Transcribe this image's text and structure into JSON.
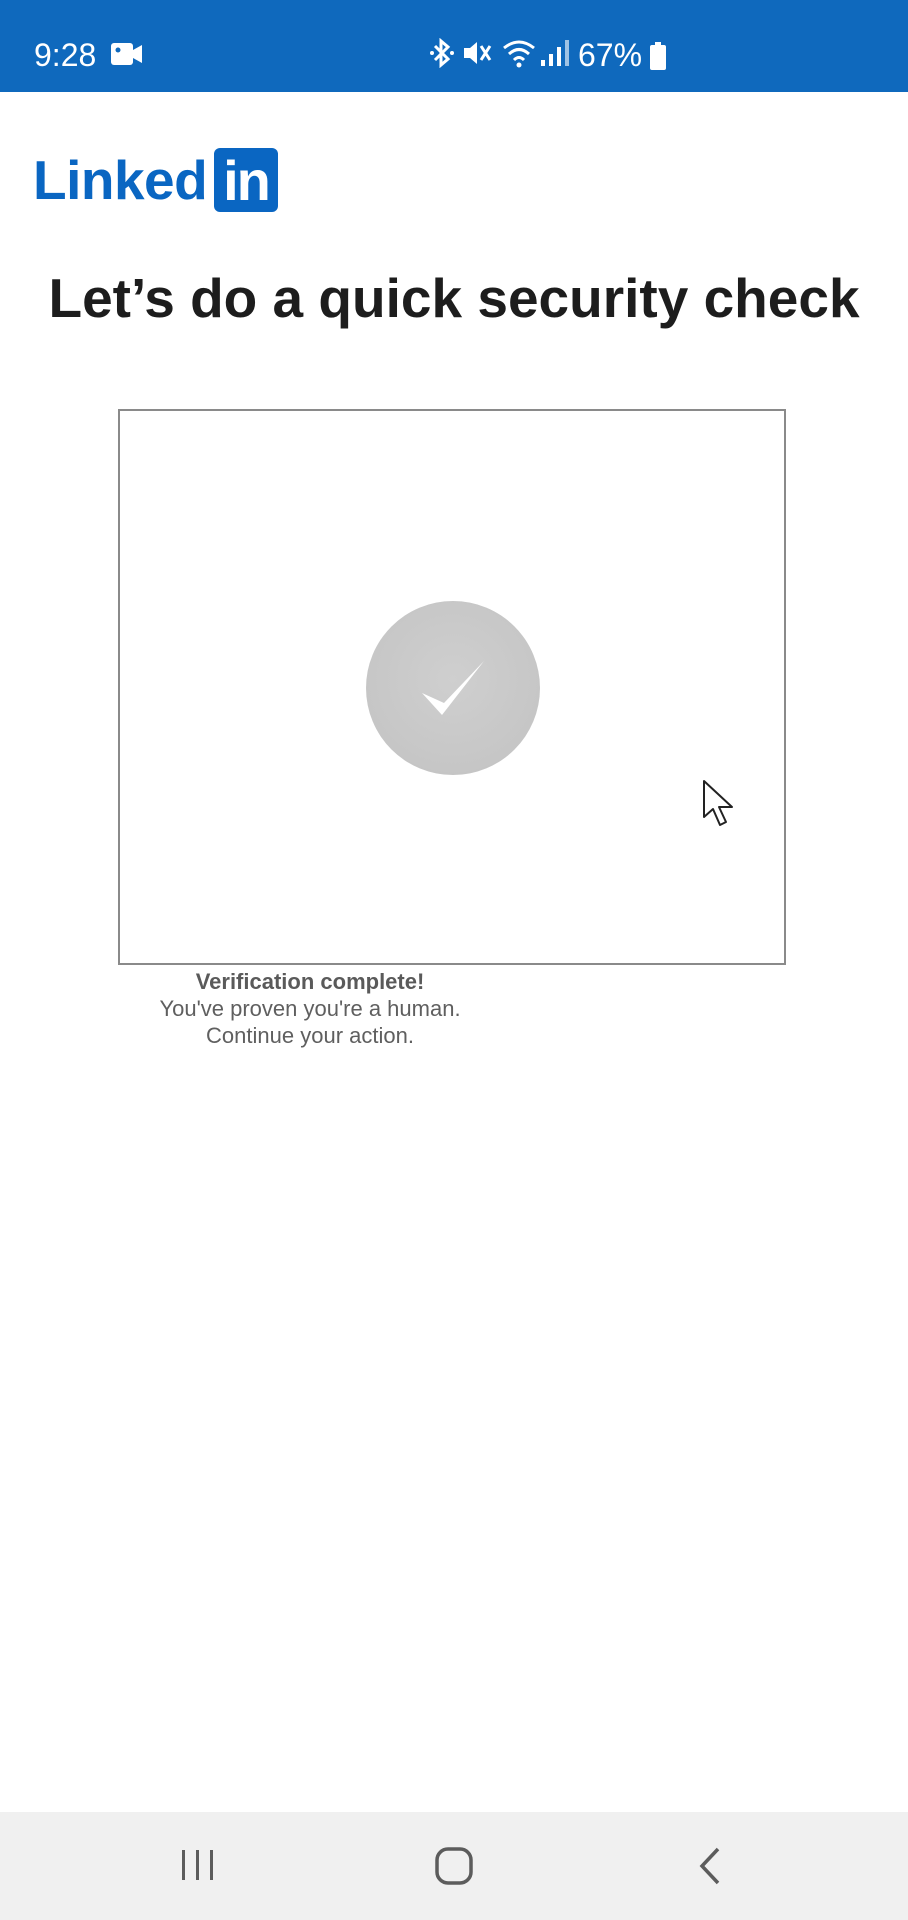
{
  "status_bar": {
    "time": "9:28",
    "battery_percent": "67%",
    "icons": [
      "video-camera-icon",
      "bluetooth-icon",
      "mute-icon",
      "wifi-icon",
      "signal-icon",
      "battery-icon"
    ],
    "background_color": "#0f69bd"
  },
  "brand": {
    "logo_text": "Linked",
    "logo_box_text": "in",
    "color": "#0a66c2"
  },
  "page": {
    "title": "Let’s do a quick security check"
  },
  "captcha": {
    "state": "verified",
    "icon": "checkmark-icon"
  },
  "verification": {
    "title": "Verification complete!",
    "line1": "You've proven you're a human.",
    "line2": "Continue your action."
  },
  "nav_bar": {
    "buttons": [
      "recent-apps",
      "home",
      "back"
    ]
  }
}
